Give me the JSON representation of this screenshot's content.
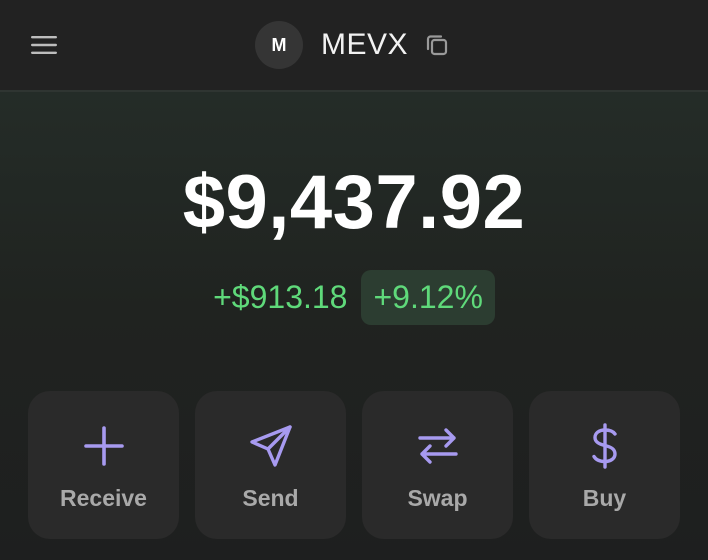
{
  "header": {
    "menu_icon": "hamburger-menu-icon",
    "avatar_letter": "M",
    "wallet_name": "MEVX",
    "copy_icon": "copy-icon"
  },
  "portfolio": {
    "balance": "$9,437.92",
    "change_amount": "+$913.18",
    "change_percent": "+9.12%",
    "change_color": "#5fd97a"
  },
  "actions": [
    {
      "label": "Receive",
      "icon": "plus-icon"
    },
    {
      "label": "Send",
      "icon": "send-icon"
    },
    {
      "label": "Swap",
      "icon": "swap-arrows-icon"
    },
    {
      "label": "Buy",
      "icon": "dollar-icon"
    }
  ],
  "colors": {
    "accent": "#a79af0",
    "background": "#222222",
    "card": "#2a2a2a"
  }
}
